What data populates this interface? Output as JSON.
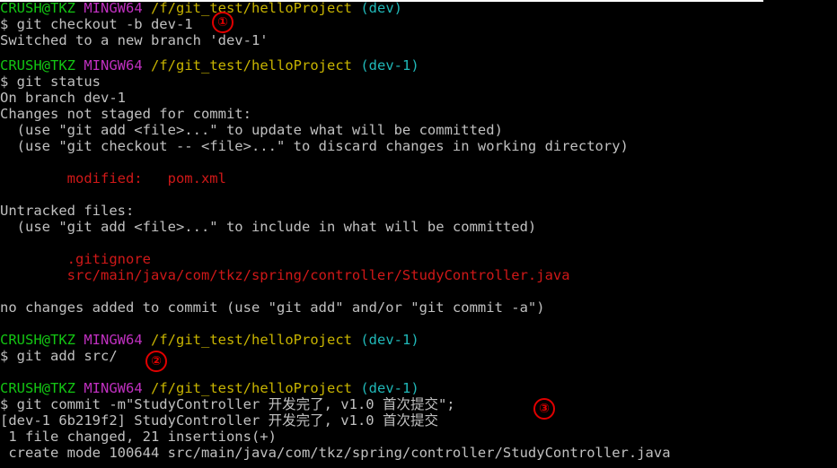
{
  "prompt": {
    "user_host": "CRUSH@TKZ",
    "env": "MINGW64",
    "path": "/f/git_test/helloProject"
  },
  "blocks": [
    {
      "branch": "(dev)",
      "command": "$ git checkout -b dev-1",
      "output": [
        "Switched to a new branch 'dev-1'"
      ]
    },
    {
      "branch": "(dev-1)",
      "command": "$ git status",
      "output_pre": [
        "On branch dev-1",
        "Changes not staged for commit:",
        "  (use \"git add <file>...\" to update what will be committed)",
        "  (use \"git checkout -- <file>...\" to discard changes in working directory)"
      ],
      "modified": "        modified:   pom.xml",
      "untracked_header": "Untracked files:",
      "untracked_hint": "  (use \"git add <file>...\" to include in what will be committed)",
      "untracked_files": [
        "        .gitignore",
        "        src/main/java/com/tkz/spring/controller/StudyController.java"
      ],
      "summary": "no changes added to commit (use \"git add\" and/or \"git commit -a\")"
    },
    {
      "branch": "(dev-1)",
      "command": "$ git add src/"
    },
    {
      "branch": "(dev-1)",
      "command": "$ git commit -m\"StudyController 开发完了, v1.0 首次提交\";",
      "output": [
        "[dev-1 6b219f2] StudyController 开发完了, v1.0 首次提交",
        " 1 file changed, 21 insertions(+)",
        " create mode 100644 src/main/java/com/tkz/spring/controller/StudyController.java"
      ]
    }
  ],
  "markers": [
    "①",
    "②",
    "③"
  ],
  "colors": {
    "background": "#000000",
    "text": "#c0c0c0",
    "user_host": "#13c613",
    "env": "#c030c0",
    "path": "#c8b400",
    "branch": "#20b8b8",
    "status_files": "#d01818",
    "marker": "#e00000"
  }
}
